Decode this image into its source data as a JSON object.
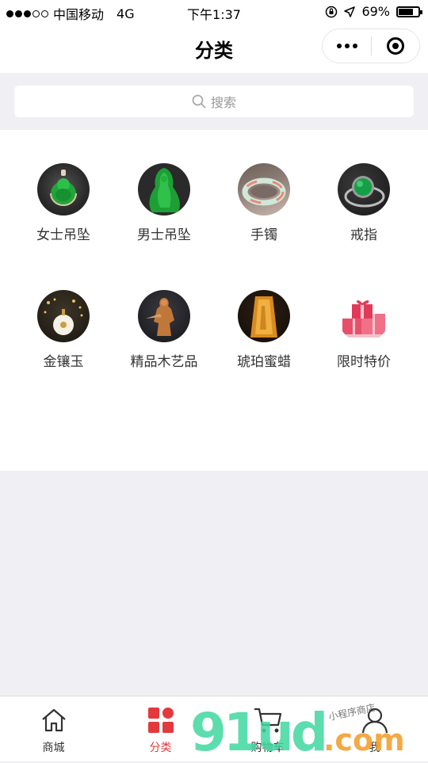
{
  "status": {
    "carrier": "中国移动",
    "network": "4G",
    "time": "下午1:37",
    "battery_text": "69%",
    "battery_level": 0.69
  },
  "navbar": {
    "title": "分类"
  },
  "search": {
    "placeholder": "搜索"
  },
  "categories": [
    {
      "label": "女士吊坠",
      "icon": "jade-buddha-pendant"
    },
    {
      "label": "男士吊坠",
      "icon": "jade-guanyin-pendant"
    },
    {
      "label": "手镯",
      "icon": "jade-bangle"
    },
    {
      "label": "戒指",
      "icon": "jade-ring"
    },
    {
      "label": "金镶玉",
      "icon": "gold-jade-pendant"
    },
    {
      "label": "精品木艺品",
      "icon": "wood-carving"
    },
    {
      "label": "琥珀蜜蜡",
      "icon": "amber"
    },
    {
      "label": "限时特价",
      "icon": "gift-boxes"
    }
  ],
  "tabs": [
    {
      "label": "商城",
      "icon": "home-icon"
    },
    {
      "label": "分类",
      "icon": "category-icon",
      "active": true
    },
    {
      "label": "购物车",
      "icon": "cart-icon"
    },
    {
      "label": "我",
      "icon": "user-icon"
    }
  ],
  "watermark": {
    "main": "91ud",
    "domain": ".com",
    "tag": "小程序商店"
  },
  "colors": {
    "accent": "#e4393c",
    "background": "#efeff4",
    "jade": "#1fa53a"
  }
}
